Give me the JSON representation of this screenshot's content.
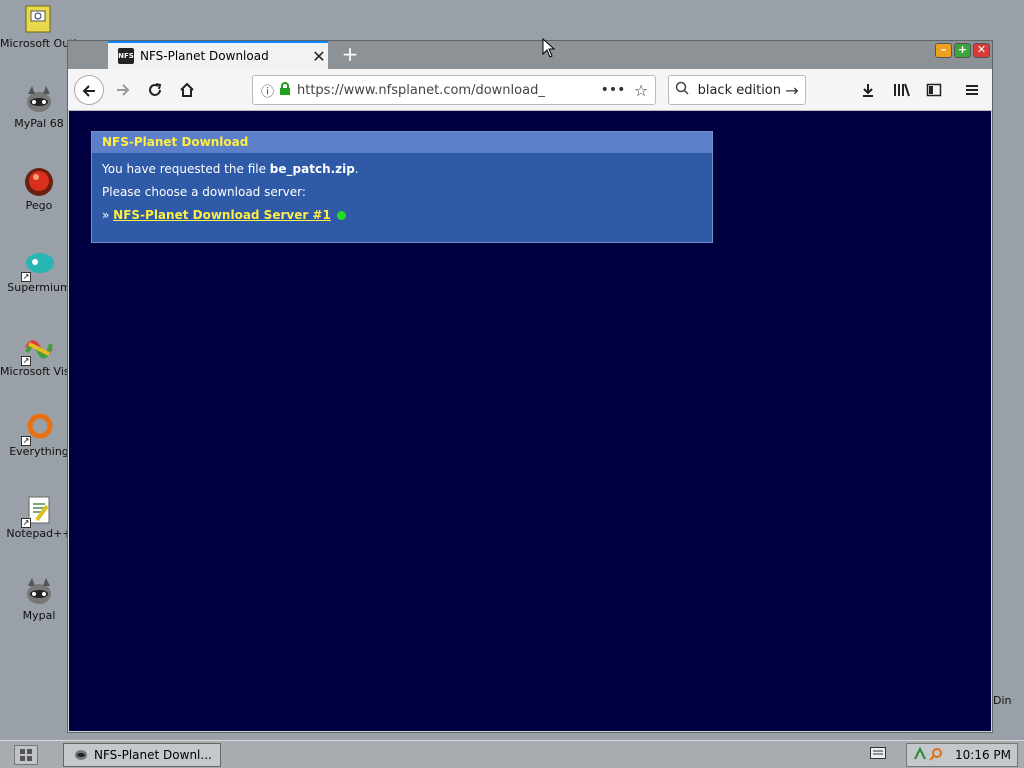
{
  "desktop": {
    "icons": [
      {
        "label": "Microsoft Outlook",
        "icon": "outlook-icon"
      },
      {
        "label": "MyPal 68",
        "icon": "raccoon-icon"
      },
      {
        "label": "Pego",
        "icon": "red-orb-icon"
      },
      {
        "label": "Supermium",
        "icon": "bird-icon"
      },
      {
        "label": "Microsoft Visual Stu...",
        "icon": "visual-studio-icon"
      },
      {
        "label": "Everything",
        "icon": "search-ring-icon"
      },
      {
        "label": "Notepad++",
        "icon": "notepad-icon"
      },
      {
        "label": "Mypal",
        "icon": "raccoon-icon"
      }
    ],
    "right_edge_text": "Din"
  },
  "browser": {
    "tab": {
      "favicon_text": "NFS",
      "title": "NFS-Planet Download",
      "close": "✕"
    },
    "new_tab": "+",
    "url": "https://www.nfsplanet.com/download_",
    "url_more": "•••",
    "search_value": "black edition",
    "window_controls": {
      "min": "–",
      "max": "+",
      "close": "✕"
    }
  },
  "page": {
    "box_title": "NFS-Planet Download",
    "requested_prefix": "You have requested the file ",
    "filename": "be_patch.zip",
    "requested_suffix": ".",
    "choose_server": "Please choose a download server:",
    "link_prefix": "» ",
    "server_link": "NFS-Planet Download Server #1",
    "server_status_color": "#22dd22"
  },
  "taskbar": {
    "task_label": "NFS-Planet Downl...",
    "clock": "10:16 PM"
  }
}
